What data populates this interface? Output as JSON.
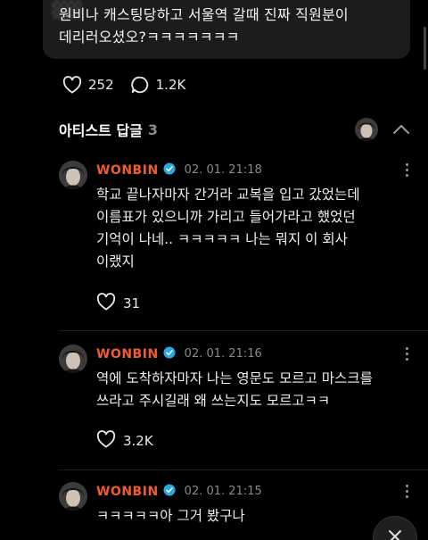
{
  "post": {
    "text_line1": "원비나 캐스팅당하고 서울역 갈때 진짜 직원분이",
    "text_line2": "데리러오셨오?ㅋㅋㅋㅋㅋㅋㅋ"
  },
  "stats": {
    "likes": "252",
    "comments": "1.2K"
  },
  "artist_replies": {
    "title": "아티스트 답글",
    "count": "3"
  },
  "replies": [
    {
      "author": "WONBIN",
      "date": "02. 01. 21:18",
      "lines": [
        "학교 끝나자마자 간거라 교복을 입고 갔었는데",
        "이름표가 있으니까 가리고 들어가라고 했었던",
        "기억이 나네.. ㅋㅋㅋㅋㅋ 나는 뭐지 이 회사",
        "이랬지"
      ],
      "likes": "31"
    },
    {
      "author": "WONBIN",
      "date": "02. 01. 21:16",
      "lines": [
        "역에 도착하자마자 나는 영문도 모르고 마스크를",
        "쓰라고 주시길래 왜 쓰는지도 모르고ㅋㅋ"
      ],
      "likes": "3.2K"
    },
    {
      "author": "WONBIN",
      "date": "02. 01. 21:15",
      "lines": [
        "ㅋㅋㅋㅋㅋ아 그거 봤구나"
      ],
      "likes": ""
    }
  ],
  "colors": {
    "author": "#f25c2a",
    "verified": "#2aa9e0",
    "background": "#000000"
  },
  "icons": {
    "like": "heart-outline-icon",
    "comment": "speech-bubble-icon",
    "collapse": "chevron-up-icon",
    "more": "vertical-dots-icon",
    "close": "close-icon"
  }
}
